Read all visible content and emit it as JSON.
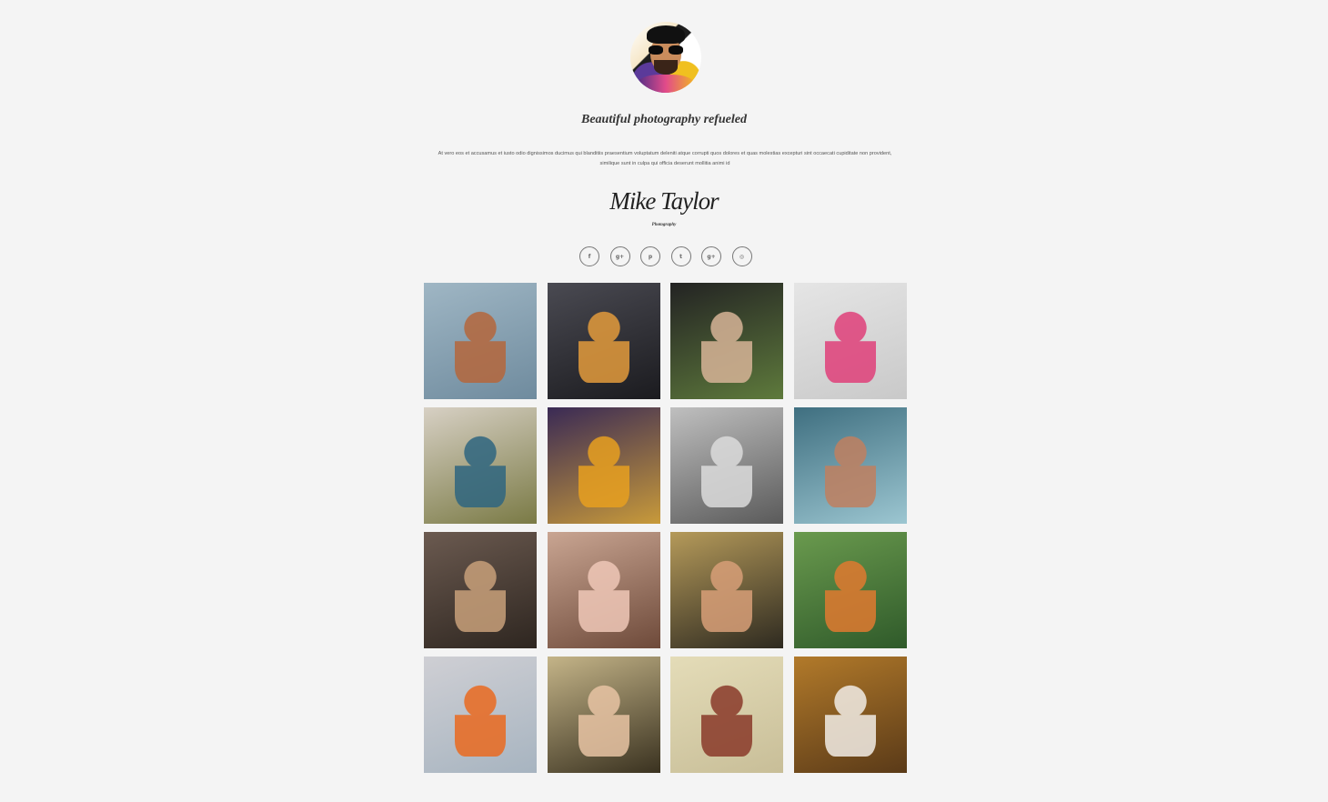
{
  "profile": {
    "avatar_alt": "photographer avatar"
  },
  "header": {
    "tagline": "Beautiful photography refueled",
    "intro": "At vero eos et accusamus et iusto odio dignissimos ducimus qui blanditiis praesentium voluptatum deleniti atque corrupti quos dolores et quas molestias excepturi sint occaecati cupiditate non provident, similique sunt in culpa qui officia deserunt mollitia animi id",
    "signature": "Mike Taylor",
    "signature_subtitle": "Photography"
  },
  "social": [
    {
      "name": "facebook",
      "glyph": "f",
      "icon": "facebook-icon"
    },
    {
      "name": "google-plus",
      "glyph": "g+",
      "icon": "google-plus-icon"
    },
    {
      "name": "pinterest",
      "glyph": "p",
      "icon": "pinterest-icon"
    },
    {
      "name": "twitter",
      "glyph": "t",
      "icon": "twitter-icon"
    },
    {
      "name": "google-plus-alt",
      "glyph": "g+",
      "icon": "google-plus-alt-icon"
    },
    {
      "name": "dribbble",
      "glyph": "◎",
      "icon": "dribbble-icon"
    }
  ],
  "gallery": [
    {
      "name": "red-haired-woman-portrait",
      "bg": [
        "#9fb6c4",
        "#6f8b9e"
      ],
      "accent": "#b5673c"
    },
    {
      "name": "light-bulb-sunset",
      "bg": [
        "#4a4a52",
        "#1b1b1f"
      ],
      "accent": "#e39b3c"
    },
    {
      "name": "woman-with-mirror-hoop",
      "bg": [
        "#232323",
        "#5e7a3c"
      ],
      "accent": "#d7b497"
    },
    {
      "name": "colorful-painted-man",
      "bg": [
        "#e5e5e5",
        "#c9c9c9"
      ],
      "accent": "#e0407a"
    },
    {
      "name": "girl-with-butterfly-wings",
      "bg": [
        "#d7d0c4",
        "#7a7a45"
      ],
      "accent": "#2f6680"
    },
    {
      "name": "painted-dog",
      "bg": [
        "#3a2a55",
        "#c89a3a"
      ],
      "accent": "#e8a020"
    },
    {
      "name": "dancers-black-and-white",
      "bg": [
        "#bfbfbf",
        "#5a5a5a"
      ],
      "accent": "#dcdcdc"
    },
    {
      "name": "children-at-sea",
      "bg": [
        "#3f6f80",
        "#9cc6d1"
      ],
      "accent": "#c08060"
    },
    {
      "name": "elderly-woman-smoking",
      "bg": [
        "#6b5a50",
        "#2e2620"
      ],
      "accent": "#c8a07a"
    },
    {
      "name": "sleeping-baby",
      "bg": [
        "#c9a592",
        "#6e4a3a"
      ],
      "accent": "#f0c8b8"
    },
    {
      "name": "woman-by-water",
      "bg": [
        "#b59a5a",
        "#2e2a20"
      ],
      "accent": "#d89f78"
    },
    {
      "name": "child-with-flowers",
      "bg": [
        "#6a9a4e",
        "#2f5a2a"
      ],
      "accent": "#e07a30"
    },
    {
      "name": "blonde-child",
      "bg": [
        "#cfcfd4",
        "#a7b4c0"
      ],
      "accent": "#ea6a20"
    },
    {
      "name": "woman-with-flowing-hair",
      "bg": [
        "#c4b488",
        "#3a3220"
      ],
      "accent": "#e8c4a4"
    },
    {
      "name": "girl-with-glasses",
      "bg": [
        "#e4dcb8",
        "#c8be98"
      ],
      "accent": "#8a3a2a"
    },
    {
      "name": "wedding-couple",
      "bg": [
        "#b27a2a",
        "#5a3a18"
      ],
      "accent": "#f2ede6"
    }
  ]
}
